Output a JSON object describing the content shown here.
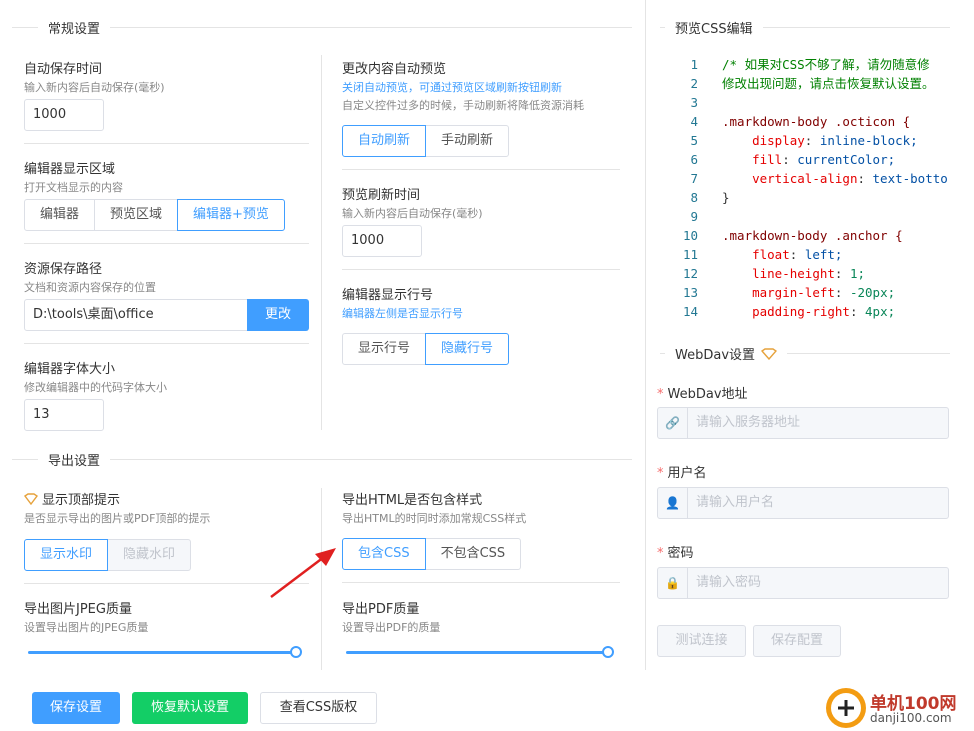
{
  "general": {
    "title": "常规设置",
    "autosave": {
      "label": "自动保存时间",
      "desc": "输入新内容后自动保存(毫秒)",
      "value": "1000"
    },
    "editor_area": {
      "label": "编辑器显示区域",
      "desc": "打开文档显示的内容",
      "options": [
        "编辑器",
        "预览区域",
        "编辑器+预览"
      ]
    },
    "resource_path": {
      "label": "资源保存路径",
      "desc": "文档和资源内容保存的位置",
      "value": "D:\\tools\\桌面\\office",
      "button": "更改"
    },
    "font_size": {
      "label": "编辑器字体大小",
      "desc": "修改编辑器中的代码字体大小",
      "value": "13"
    },
    "auto_preview": {
      "label": "更改内容自动预览",
      "desc1": "关闭自动预览，可通过预览区域刷新按钮刷新",
      "desc2": "自定义控件过多的时候，手动刷新将降低资源消耗",
      "options": [
        "自动刷新",
        "手动刷新"
      ]
    },
    "preview_refresh": {
      "label": "预览刷新时间",
      "desc": "输入新内容后自动保存(毫秒)",
      "value": "1000"
    },
    "line_numbers": {
      "label": "编辑器显示行号",
      "desc": "编辑器左侧是否显示行号",
      "options": [
        "显示行号",
        "隐藏行号"
      ]
    }
  },
  "export": {
    "title": "导出设置",
    "top_hint": {
      "label": "显示顶部提示",
      "desc": "是否显示导出的图片或PDF顶部的提示",
      "options": [
        "显示水印",
        "隐藏水印"
      ]
    },
    "html_style": {
      "label": "导出HTML是否包含样式",
      "desc": "导出HTML的时同时添加常规CSS样式",
      "options": [
        "包含CSS",
        "不包含CSS"
      ]
    },
    "jpeg_quality": {
      "label": "导出图片JPEG质量",
      "desc": "设置导出图片的JPEG质量",
      "fraction": 1.0
    },
    "pdf_quality": {
      "label": "导出PDF质量",
      "desc": "设置导出PDF的质量",
      "fraction": 1.0
    }
  },
  "css_preview": {
    "title": "预览CSS编辑",
    "line_numbers": [
      "1",
      "2",
      "3",
      "4",
      "5",
      "6",
      "7",
      "8",
      "9",
      "10",
      "11",
      "12",
      "13",
      "14"
    ],
    "comment1": "/* 如果对CSS不够了解，请勿随意修",
    "comment2": "修改出现问题，请点击恢复默认设置。",
    "sel1": ".markdown-body .octicon {",
    "l5p": "display",
    "l5v": "inline-block;",
    "l6p": "fill",
    "l6v": "currentColor;",
    "l7p": "vertical-align",
    "l7v": "text-botto",
    "close": "}",
    "sel2": ".markdown-body .anchor {",
    "l11p": "float",
    "l11v": "left;",
    "l12p": "line-height",
    "l12v": "1;",
    "l13p": "margin-left",
    "l13v": "-20px;",
    "l14p": "padding-right",
    "l14v": "4px;"
  },
  "webdav": {
    "title": "WebDav设置",
    "address": {
      "label": "WebDav地址",
      "placeholder": "请输入服务器地址"
    },
    "username": {
      "label": "用户名",
      "placeholder": "请输入用户名"
    },
    "password": {
      "label": "密码",
      "placeholder": "请输入密码"
    },
    "test_button": "测试连接",
    "save_button": "保存配置"
  },
  "footer": {
    "save": "保存设置",
    "reset": "恢复默认设置",
    "copyright": "查看CSS版权"
  },
  "watermark": {
    "name": "单机100网",
    "url": "danji100.com"
  },
  "colors": {
    "primary": "#409eff",
    "success": "#13ce66",
    "arrow": "#e02020",
    "warning": "#e6a23c"
  }
}
